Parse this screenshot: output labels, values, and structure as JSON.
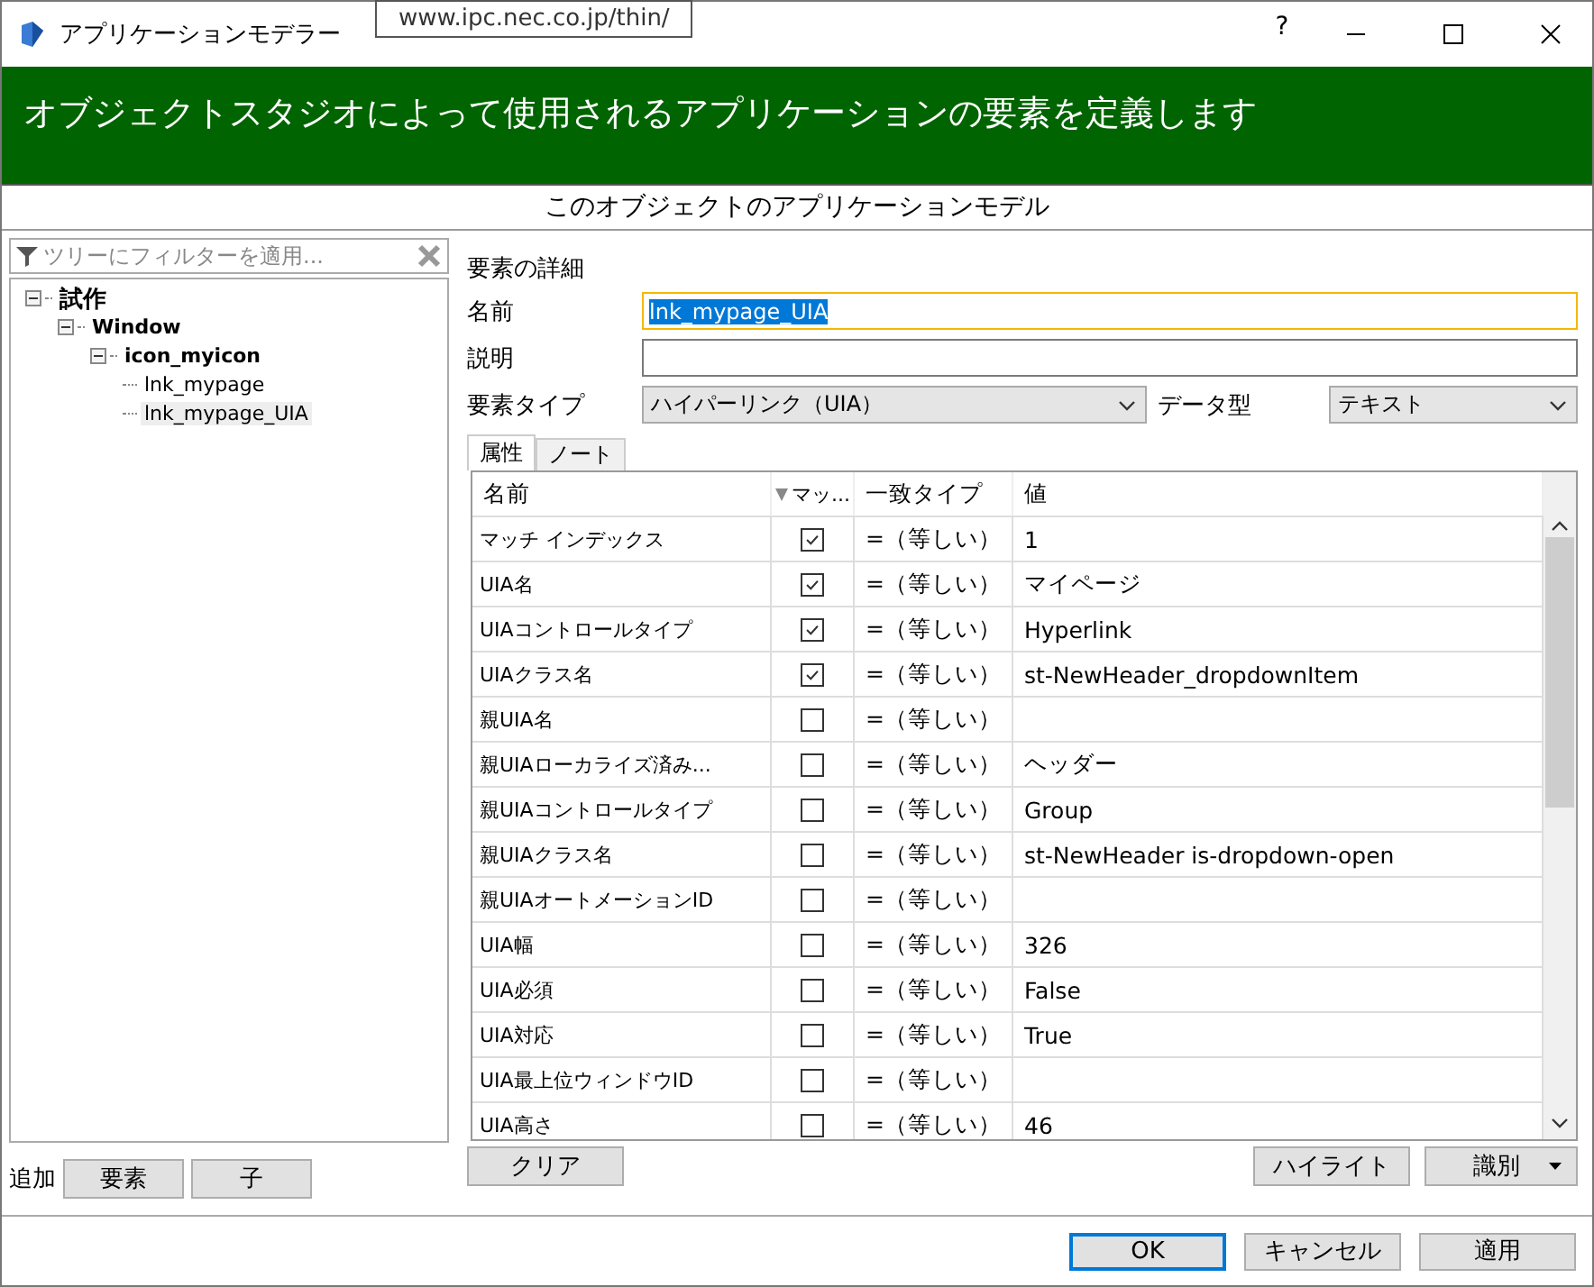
{
  "window": {
    "title": "アプリケーションモデラー",
    "help": "?"
  },
  "tooltip": "www.ipc.nec.co.jp/thin/",
  "banner": "オブジェクトスタジオによって使用されるアプリケーションの要素を定義します",
  "subtitle": "このオブジェクトのアプリケーションモデル",
  "filter": {
    "placeholder": "ツリーにフィルターを適用..."
  },
  "tree": [
    {
      "label": "試作",
      "expanded": true,
      "selected": false,
      "children": [
        {
          "label": "Window",
          "expanded": true,
          "selected": false,
          "children": [
            {
              "label": "icon_myicon",
              "expanded": true,
              "selected": false,
              "children": [
                {
                  "label": "lnk_mypage",
                  "selected": false
                },
                {
                  "label": "lnk_mypage_UIA",
                  "selected": true
                }
              ]
            }
          ]
        }
      ]
    }
  ],
  "add": {
    "label": "追加",
    "buttons": [
      "要素",
      "子"
    ]
  },
  "details": {
    "heading": "要素の詳細",
    "name_label": "名前",
    "name_value": "lnk_mypage_UIA",
    "desc_label": "説明",
    "type_label": "要素タイプ",
    "type_value": "ハイパーリンク（UIA）",
    "datatype_label": "データ型",
    "datatype_value": "テキスト"
  },
  "tabs": [
    {
      "label": "属性",
      "selected": true
    },
    {
      "label": "ノート",
      "selected": false
    }
  ],
  "table": {
    "columns": [
      "名前",
      "マッ...",
      "一致タイプ",
      "値"
    ],
    "rows": [
      {
        "name": "マッチ インデックス",
        "checked": true,
        "match": "=（等しい）",
        "value": "1"
      },
      {
        "name": "UIA名",
        "checked": true,
        "match": "=（等しい）",
        "value": "マイページ"
      },
      {
        "name": "UIAコントロールタイプ",
        "checked": true,
        "match": "=（等しい）",
        "value": "Hyperlink"
      },
      {
        "name": "UIAクラス名",
        "checked": true,
        "match": "=（等しい）",
        "value": "st-NewHeader_dropdownItem"
      },
      {
        "name": "親UIA名",
        "checked": false,
        "match": "=（等しい）",
        "value": ""
      },
      {
        "name": "親UIAローカライズ済み...",
        "checked": false,
        "match": "=（等しい）",
        "value": "ヘッダー"
      },
      {
        "name": "親UIAコントロールタイプ",
        "checked": false,
        "match": "=（等しい）",
        "value": "Group"
      },
      {
        "name": "親UIAクラス名",
        "checked": false,
        "match": "=（等しい）",
        "value": "st-NewHeader is-dropdown-open"
      },
      {
        "name": "親UIAオートメーションID",
        "checked": false,
        "match": "=（等しい）",
        "value": ""
      },
      {
        "name": "UIA幅",
        "checked": false,
        "match": "=（等しい）",
        "value": "326"
      },
      {
        "name": "UIA必須",
        "checked": false,
        "match": "=（等しい）",
        "value": "False"
      },
      {
        "name": "UIA対応",
        "checked": false,
        "match": "=（等しい）",
        "value": "True"
      },
      {
        "name": "UIA最上位ウィンドウID",
        "checked": false,
        "match": "=（等しい）",
        "value": ""
      },
      {
        "name": "UIA高さ",
        "checked": false,
        "match": "=（等しい）",
        "value": "46"
      }
    ]
  },
  "clear_button": "クリア",
  "highlight_button": "ハイライト",
  "identify_button": "識別",
  "footer_buttons": [
    {
      "label": "OK",
      "default": true
    },
    {
      "label": "キャンセル",
      "default": false
    },
    {
      "label": "適用",
      "default": false
    }
  ]
}
